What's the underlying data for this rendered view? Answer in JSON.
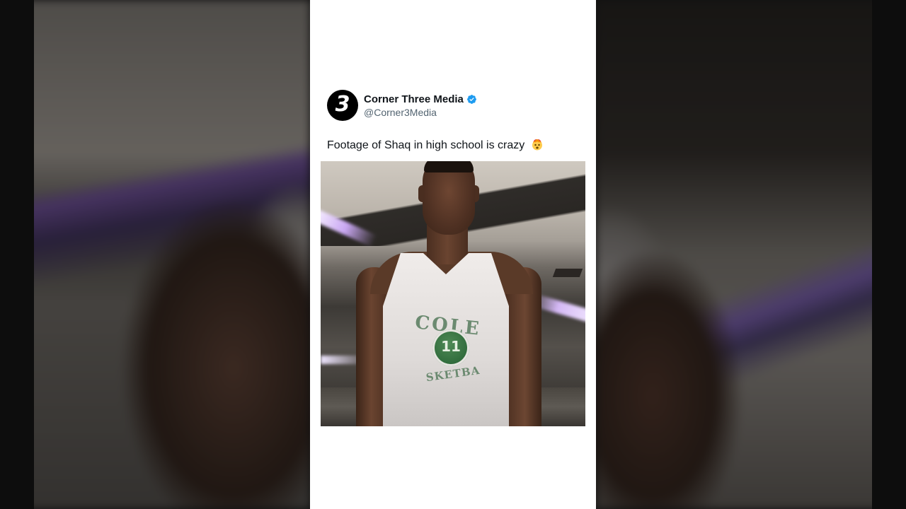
{
  "background": {
    "accent_color": "#8a6cc4"
  },
  "tweet": {
    "avatar_glyph": "3",
    "display_name": "Corner Three Media",
    "verified": true,
    "verified_color": "#1d9bf0",
    "handle": "@Corner3Media",
    "text": "Footage of Shaq in high school is crazy",
    "emoji_name": "exploding-head-emoji"
  },
  "media": {
    "jersey_top_text": "COLE",
    "jersey_number": "11",
    "jersey_bottom_text": "SKETBA",
    "jersey_color": "#6b8a70"
  }
}
